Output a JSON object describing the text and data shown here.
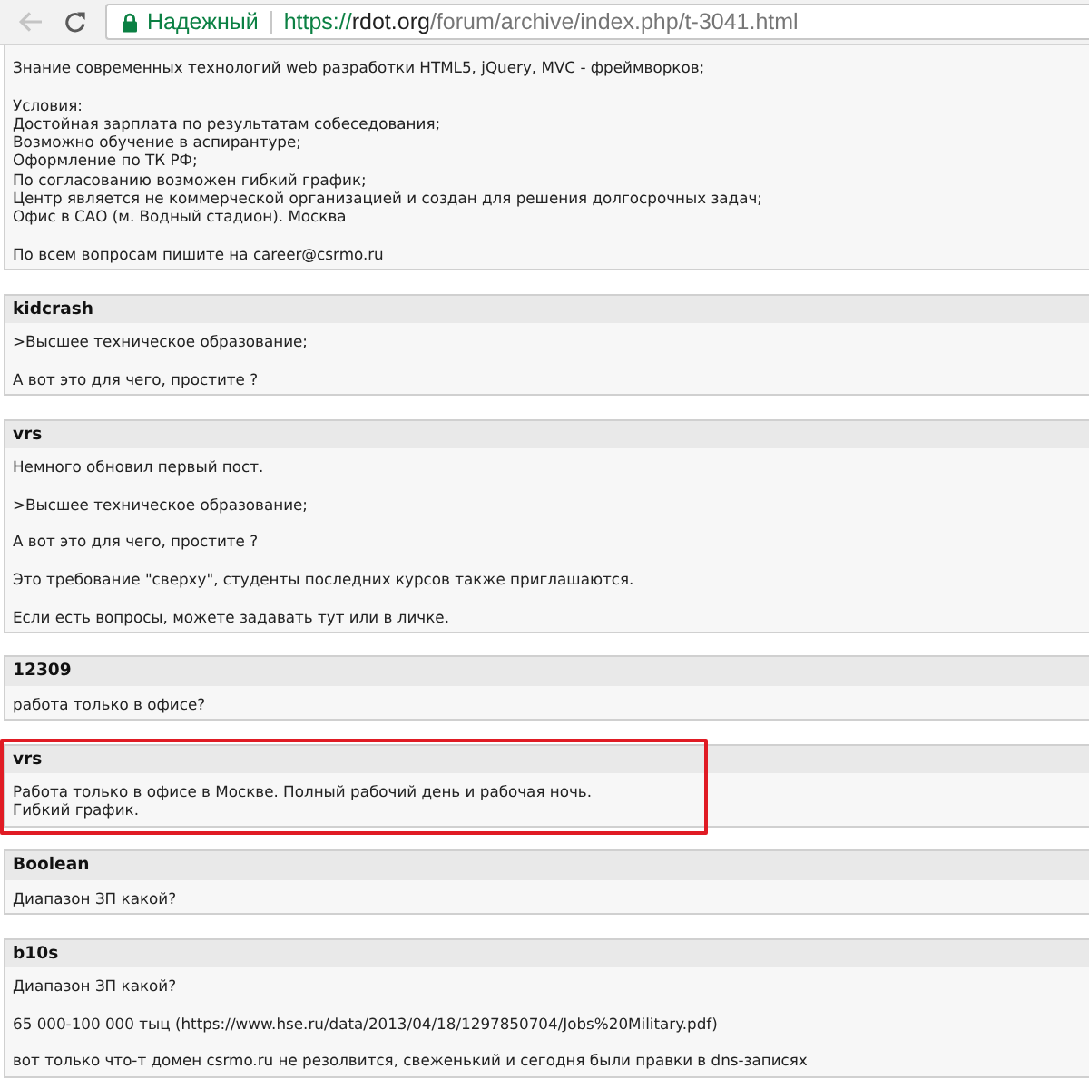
{
  "browser": {
    "back_button": {
      "disabled": true
    },
    "security_label": "Надежный",
    "url": {
      "scheme": "https://",
      "host": "rdot.org",
      "path": "/forum/archive/index.php/t-3041.html"
    }
  },
  "posts": [
    {
      "highlighted": false,
      "paragraphs": [
        [
          "Знание современных технологий web разработки HTML5, jQuery, MVC - фреймворков;"
        ],
        [
          "Условия:",
          "Достойная зарплата по результатам собеседования;",
          "Возможно обучение в аспирантуре;",
          "Оформление по ТК РФ;",
          "По согласованию возможен гибкий график;",
          "Центр является не коммерческой организацией и создан для решения долгосрочных задач;",
          "Офис в САО (м. Водный стадион). Москва"
        ],
        [
          "По всем вопросам пишите на career@csrmo.ru"
        ]
      ]
    },
    {
      "author": "kidcrash",
      "highlighted": false,
      "paragraphs": [
        [
          ">Высшее техническое образование;"
        ],
        [
          "А вот это для чего, простите ?"
        ]
      ]
    },
    {
      "author": "vrs",
      "highlighted": false,
      "paragraphs": [
        [
          "Немного обновил первый пост."
        ],
        [
          ">Высшее техническое образование;"
        ],
        [
          "А вот это для чего, простите ?"
        ],
        [
          "Это требование \"сверху\", студенты последних курсов также приглашаются."
        ],
        [
          "Если есть вопросы, можете задавать тут или в личке."
        ]
      ]
    },
    {
      "author": "12309",
      "highlighted": false,
      "paragraphs": [
        [
          "работа только в офисе?"
        ]
      ]
    },
    {
      "author": "vrs",
      "highlighted": true,
      "paragraphs": [
        [
          "Работа только в офисе в Москве. Полный рабочий день и рабочая ночь.",
          "Гибкий график."
        ]
      ]
    },
    {
      "author": "Boolean",
      "highlighted": false,
      "paragraphs": [
        [
          "Диапазон ЗП какой?"
        ]
      ]
    },
    {
      "author": "b10s",
      "highlighted": false,
      "paragraphs": [
        [
          "Диапазон ЗП какой?"
        ],
        [
          "65 000-100 000 тыц (https://www.hse.ru/data/2013/04/18/1297850704/Jobs%20Military.pdf)"
        ],
        [
          "вот только что-т домен csrmo.ru не резолвится, свеженький и сегодня были правки в dns-записях"
        ]
      ]
    }
  ]
}
